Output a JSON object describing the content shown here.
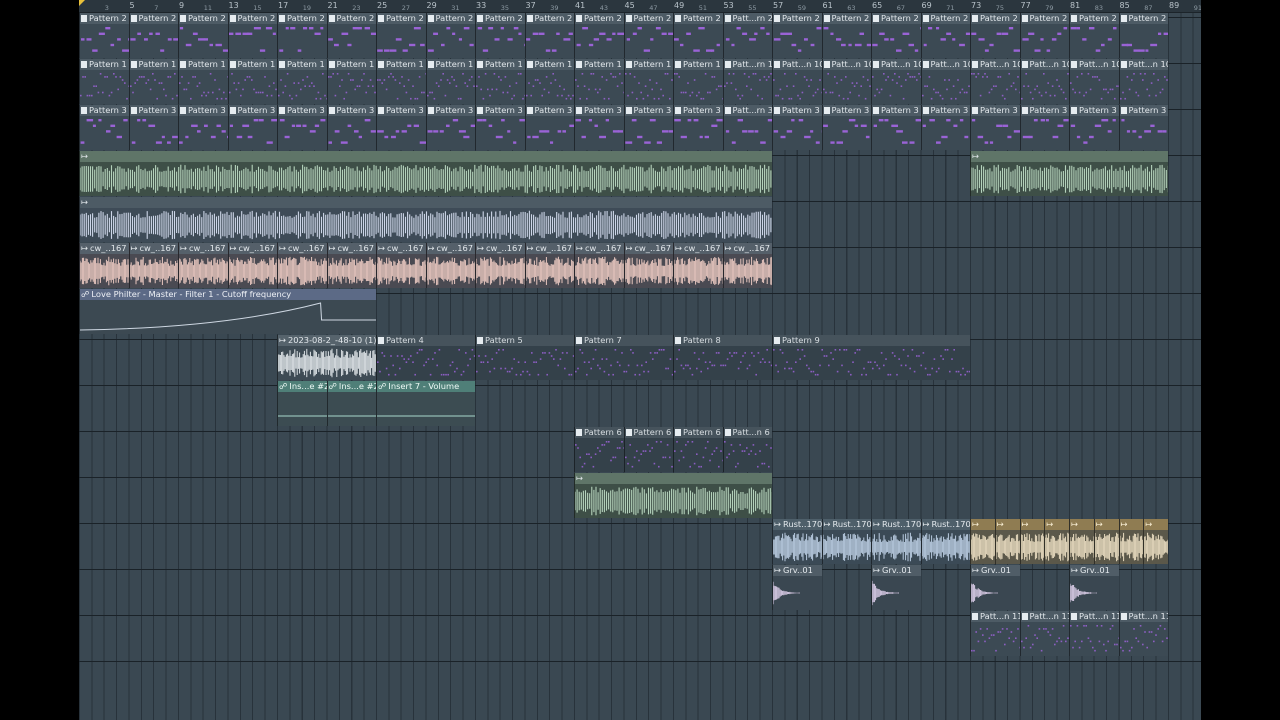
{
  "playlist": {
    "ruler_bars": [
      3,
      5,
      7,
      9,
      11,
      13,
      15,
      17,
      19,
      21,
      23,
      25,
      27,
      29,
      31,
      33,
      35,
      37,
      39,
      41,
      43,
      45,
      47,
      49,
      51,
      53,
      55,
      57,
      59,
      61,
      63,
      65,
      67,
      69,
      71,
      73,
      75,
      77,
      79,
      81,
      83,
      85,
      87,
      89,
      91
    ],
    "clips": [
      {
        "label": "Pattern 2",
        "kind": "pattern",
        "track": 0,
        "start": 1,
        "len": 4
      },
      {
        "label": "Pattern 2",
        "kind": "pattern",
        "track": 0,
        "start": 5,
        "len": 4
      },
      {
        "label": "Pattern 2",
        "kind": "pattern",
        "track": 0,
        "start": 9,
        "len": 4
      },
      {
        "label": "Pattern 2",
        "kind": "pattern",
        "track": 0,
        "start": 13,
        "len": 4
      },
      {
        "label": "Pattern 2",
        "kind": "pattern",
        "track": 0,
        "start": 17,
        "len": 4
      },
      {
        "label": "Pattern 2",
        "kind": "pattern",
        "track": 0,
        "start": 21,
        "len": 4
      },
      {
        "label": "Pattern 2",
        "kind": "pattern",
        "track": 0,
        "start": 25,
        "len": 4
      },
      {
        "label": "Pattern 2",
        "kind": "pattern",
        "track": 0,
        "start": 29,
        "len": 4
      },
      {
        "label": "Pattern 2",
        "kind": "pattern",
        "track": 0,
        "start": 33,
        "len": 4
      },
      {
        "label": "Pattern 2",
        "kind": "pattern",
        "track": 0,
        "start": 37,
        "len": 4
      },
      {
        "label": "Pattern 2",
        "kind": "pattern",
        "track": 0,
        "start": 41,
        "len": 4
      },
      {
        "label": "Pattern 2",
        "kind": "pattern",
        "track": 0,
        "start": 45,
        "len": 4
      },
      {
        "label": "Pattern 2",
        "kind": "pattern",
        "track": 0,
        "start": 49,
        "len": 4
      },
      {
        "label": "Patt...rn 2",
        "kind": "pattern",
        "track": 0,
        "start": 53,
        "len": 4
      },
      {
        "label": "Pattern 2",
        "kind": "pattern",
        "track": 0,
        "start": 57,
        "len": 4
      },
      {
        "label": "Pattern 2",
        "kind": "pattern",
        "track": 0,
        "start": 61,
        "len": 4
      },
      {
        "label": "Pattern 2",
        "kind": "pattern",
        "track": 0,
        "start": 65,
        "len": 4
      },
      {
        "label": "Pattern 2",
        "kind": "pattern",
        "track": 0,
        "start": 69,
        "len": 4
      },
      {
        "label": "Pattern 2",
        "kind": "pattern",
        "track": 0,
        "start": 73,
        "len": 4
      },
      {
        "label": "Pattern 2",
        "kind": "pattern",
        "track": 0,
        "start": 77,
        "len": 4
      },
      {
        "label": "Pattern 2",
        "kind": "pattern",
        "track": 0,
        "start": 81,
        "len": 4
      },
      {
        "label": "Pattern 2",
        "kind": "pattern",
        "track": 0,
        "start": 85,
        "len": 4
      },
      {
        "label": "Pattern 1",
        "kind": "pattern",
        "track": 1,
        "start": 1,
        "len": 4
      },
      {
        "label": "Pattern 1",
        "kind": "pattern",
        "track": 1,
        "start": 5,
        "len": 4
      },
      {
        "label": "Pattern 1",
        "kind": "pattern",
        "track": 1,
        "start": 9,
        "len": 4
      },
      {
        "label": "Pattern 1",
        "kind": "pattern",
        "track": 1,
        "start": 13,
        "len": 4
      },
      {
        "label": "Pattern 1",
        "kind": "pattern",
        "track": 1,
        "start": 17,
        "len": 4
      },
      {
        "label": "Pattern 1",
        "kind": "pattern",
        "track": 1,
        "start": 21,
        "len": 4
      },
      {
        "label": "Pattern 1",
        "kind": "pattern",
        "track": 1,
        "start": 25,
        "len": 4
      },
      {
        "label": "Pattern 1",
        "kind": "pattern",
        "track": 1,
        "start": 29,
        "len": 4
      },
      {
        "label": "Pattern 1",
        "kind": "pattern",
        "track": 1,
        "start": 33,
        "len": 4
      },
      {
        "label": "Pattern 1",
        "kind": "pattern",
        "track": 1,
        "start": 37,
        "len": 4
      },
      {
        "label": "Pattern 1",
        "kind": "pattern",
        "track": 1,
        "start": 41,
        "len": 4
      },
      {
        "label": "Pattern 1",
        "kind": "pattern",
        "track": 1,
        "start": 45,
        "len": 4
      },
      {
        "label": "Pattern 1",
        "kind": "pattern",
        "track": 1,
        "start": 49,
        "len": 4
      },
      {
        "label": "Patt...rn 1",
        "kind": "pattern",
        "track": 1,
        "start": 53,
        "len": 4
      },
      {
        "label": "Patt...n 10",
        "kind": "pattern",
        "track": 1,
        "start": 57,
        "len": 4
      },
      {
        "label": "Patt...n 10",
        "kind": "pattern",
        "track": 1,
        "start": 61,
        "len": 4
      },
      {
        "label": "Patt...n 10",
        "kind": "pattern",
        "track": 1,
        "start": 65,
        "len": 4
      },
      {
        "label": "Patt...n 10",
        "kind": "pattern",
        "track": 1,
        "start": 69,
        "len": 4
      },
      {
        "label": "Patt...n 10",
        "kind": "pattern",
        "track": 1,
        "start": 73,
        "len": 4
      },
      {
        "label": "Patt...n 10",
        "kind": "pattern",
        "track": 1,
        "start": 77,
        "len": 4
      },
      {
        "label": "Patt...n 10",
        "kind": "pattern",
        "track": 1,
        "start": 81,
        "len": 4
      },
      {
        "label": "Patt...n 10",
        "kind": "pattern",
        "track": 1,
        "start": 85,
        "len": 4
      },
      {
        "label": "Pattern 3",
        "kind": "pattern",
        "track": 2,
        "start": 1,
        "len": 4
      },
      {
        "label": "Pattern 3",
        "kind": "pattern",
        "track": 2,
        "start": 5,
        "len": 4
      },
      {
        "label": "Pattern 3",
        "kind": "pattern",
        "track": 2,
        "start": 9,
        "len": 4
      },
      {
        "label": "Pattern 3",
        "kind": "pattern",
        "track": 2,
        "start": 13,
        "len": 4
      },
      {
        "label": "Pattern 3",
        "kind": "pattern",
        "track": 2,
        "start": 17,
        "len": 4
      },
      {
        "label": "Pattern 3",
        "kind": "pattern",
        "track": 2,
        "start": 21,
        "len": 4
      },
      {
        "label": "Pattern 3",
        "kind": "pattern",
        "track": 2,
        "start": 25,
        "len": 4
      },
      {
        "label": "Pattern 3",
        "kind": "pattern",
        "track": 2,
        "start": 29,
        "len": 4
      },
      {
        "label": "Pattern 3",
        "kind": "pattern",
        "track": 2,
        "start": 33,
        "len": 4
      },
      {
        "label": "Pattern 3",
        "kind": "pattern",
        "track": 2,
        "start": 37,
        "len": 4
      },
      {
        "label": "Pattern 3",
        "kind": "pattern",
        "track": 2,
        "start": 41,
        "len": 4
      },
      {
        "label": "Pattern 3",
        "kind": "pattern",
        "track": 2,
        "start": 45,
        "len": 4
      },
      {
        "label": "Pattern 3",
        "kind": "pattern",
        "track": 2,
        "start": 49,
        "len": 4
      },
      {
        "label": "Patt...rn 3",
        "kind": "pattern",
        "track": 2,
        "start": 53,
        "len": 4
      },
      {
        "label": "Pattern 3",
        "kind": "pattern",
        "track": 2,
        "start": 57,
        "len": 4
      },
      {
        "label": "Pattern 3",
        "kind": "pattern",
        "track": 2,
        "start": 61,
        "len": 4
      },
      {
        "label": "Pattern 3",
        "kind": "pattern",
        "track": 2,
        "start": 65,
        "len": 4
      },
      {
        "label": "Pattern 3",
        "kind": "pattern",
        "track": 2,
        "start": 69,
        "len": 4
      },
      {
        "label": "Pattern 3",
        "kind": "pattern",
        "track": 2,
        "start": 73,
        "len": 4
      },
      {
        "label": "Pattern 3",
        "kind": "pattern",
        "track": 2,
        "start": 77,
        "len": 4
      },
      {
        "label": "Pattern 3",
        "kind": "pattern",
        "track": 2,
        "start": 81,
        "len": 4
      },
      {
        "label": "Pattern 3",
        "kind": "pattern",
        "track": 2,
        "start": 85,
        "len": 4
      },
      {
        "label": "",
        "kind": "audio-green",
        "track": 3,
        "start": 1,
        "len": 56
      },
      {
        "label": "",
        "kind": "audio-green",
        "track": 3,
        "start": 73,
        "len": 16
      },
      {
        "label": "",
        "kind": "audio-blue",
        "track": 4,
        "start": 1,
        "len": 56
      },
      {
        "label": "cw_..167",
        "kind": "audio-pink",
        "track": 5,
        "start": 1,
        "len": 4
      },
      {
        "label": "cw_..167",
        "kind": "audio-pink",
        "track": 5,
        "start": 5,
        "len": 4
      },
      {
        "label": "cw_..167",
        "kind": "audio-pink",
        "track": 5,
        "start": 9,
        "len": 4
      },
      {
        "label": "cw_..167",
        "kind": "audio-pink",
        "track": 5,
        "start": 13,
        "len": 4
      },
      {
        "label": "cw_..167",
        "kind": "audio-pink",
        "track": 5,
        "start": 17,
        "len": 4
      },
      {
        "label": "cw_..167",
        "kind": "audio-pink",
        "track": 5,
        "start": 21,
        "len": 4
      },
      {
        "label": "cw_..167",
        "kind": "audio-pink",
        "track": 5,
        "start": 25,
        "len": 4
      },
      {
        "label": "cw_..167",
        "kind": "audio-pink",
        "track": 5,
        "start": 29,
        "len": 4
      },
      {
        "label": "cw_..167",
        "kind": "audio-pink",
        "track": 5,
        "start": 33,
        "len": 4
      },
      {
        "label": "cw_..167",
        "kind": "audio-pink",
        "track": 5,
        "start": 37,
        "len": 4
      },
      {
        "label": "cw_..167",
        "kind": "audio-pink",
        "track": 5,
        "start": 41,
        "len": 4
      },
      {
        "label": "cw_..167",
        "kind": "audio-pink",
        "track": 5,
        "start": 45,
        "len": 4
      },
      {
        "label": "cw_..167",
        "kind": "audio-pink",
        "track": 5,
        "start": 49,
        "len": 4
      },
      {
        "label": "cw_..167",
        "kind": "audio-pink",
        "track": 5,
        "start": 53,
        "len": 4
      },
      {
        "label": "Love Philter - Master - Filter 1 - Cutoff frequency",
        "kind": "automation",
        "track": 6,
        "start": 1,
        "len": 24
      },
      {
        "label": "2023-08-2_-48-10 (1)",
        "kind": "audio-grey",
        "track": 7,
        "start": 17,
        "len": 8
      },
      {
        "label": "Pattern 4",
        "kind": "pattern-dark",
        "track": 7,
        "start": 25,
        "len": 8
      },
      {
        "label": "Pattern 5",
        "kind": "pattern-dark",
        "track": 7,
        "start": 33,
        "len": 8
      },
      {
        "label": "Pattern 7",
        "kind": "pattern-dark",
        "track": 7,
        "start": 41,
        "len": 8
      },
      {
        "label": "Pattern 8",
        "kind": "pattern-dark",
        "track": 7,
        "start": 49,
        "len": 8
      },
      {
        "label": "Pattern 9",
        "kind": "pattern-dark",
        "track": 7,
        "start": 57,
        "len": 16
      },
      {
        "label": "Ins...e #2",
        "kind": "automation-teal",
        "track": 8,
        "start": 17,
        "len": 4
      },
      {
        "label": "Ins...e #2",
        "kind": "automation-teal",
        "track": 8,
        "start": 21,
        "len": 4
      },
      {
        "label": "Insert 7 - Volume",
        "kind": "automation-teal",
        "track": 8,
        "start": 25,
        "len": 8
      },
      {
        "label": "Pattern 6",
        "kind": "pattern-dark",
        "track": 9,
        "start": 41,
        "len": 4
      },
      {
        "label": "Pattern 6",
        "kind": "pattern-dark",
        "track": 9,
        "start": 45,
        "len": 4
      },
      {
        "label": "Pattern 6",
        "kind": "pattern-dark",
        "track": 9,
        "start": 49,
        "len": 4
      },
      {
        "label": "Patt...n 6",
        "kind": "pattern-dark",
        "track": 9,
        "start": 53,
        "len": 4
      },
      {
        "label": "",
        "kind": "audio-green",
        "track": 10,
        "start": 41,
        "len": 16
      },
      {
        "label": "Rust..170",
        "kind": "audio-blue2",
        "track": 11,
        "start": 57,
        "len": 4
      },
      {
        "label": "Rust..170",
        "kind": "audio-blue2",
        "track": 11,
        "start": 61,
        "len": 4
      },
      {
        "label": "Rust..170",
        "kind": "audio-blue2",
        "track": 11,
        "start": 65,
        "len": 4
      },
      {
        "label": "Rust..170",
        "kind": "audio-blue2",
        "track": 11,
        "start": 69,
        "len": 4
      },
      {
        "label": "",
        "kind": "audio-cream",
        "track": 11,
        "start": 73,
        "len": 2
      },
      {
        "label": "",
        "kind": "audio-cream",
        "track": 11,
        "start": 75,
        "len": 2
      },
      {
        "label": "",
        "kind": "audio-cream",
        "track": 11,
        "start": 77,
        "len": 2
      },
      {
        "label": "",
        "kind": "audio-cream",
        "track": 11,
        "start": 79,
        "len": 2
      },
      {
        "label": "",
        "kind": "audio-cream",
        "track": 11,
        "start": 81,
        "len": 2
      },
      {
        "label": "",
        "kind": "audio-cream",
        "track": 11,
        "start": 83,
        "len": 2
      },
      {
        "label": "",
        "kind": "audio-cream",
        "track": 11,
        "start": 85,
        "len": 2
      },
      {
        "label": "",
        "kind": "audio-cream",
        "track": 11,
        "start": 87,
        "len": 2
      },
      {
        "label": "Grv..01",
        "kind": "audio-lilac",
        "track": 12,
        "start": 57,
        "len": 4
      },
      {
        "label": "Grv..01",
        "kind": "audio-lilac",
        "track": 12,
        "start": 65,
        "len": 4
      },
      {
        "label": "Grv..01",
        "kind": "audio-lilac",
        "track": 12,
        "start": 73,
        "len": 4
      },
      {
        "label": "Grv..01",
        "kind": "audio-lilac",
        "track": 12,
        "start": 81,
        "len": 4
      },
      {
        "label": "Patt...n 11",
        "kind": "pattern",
        "track": 13,
        "start": 73,
        "len": 4
      },
      {
        "label": "Patt...n 11",
        "kind": "pattern",
        "track": 13,
        "start": 77,
        "len": 4
      },
      {
        "label": "Patt...n 11",
        "kind": "pattern",
        "track": 13,
        "start": 81,
        "len": 4
      },
      {
        "label": "Patt...n 11",
        "kind": "pattern",
        "track": 13,
        "start": 85,
        "len": 4
      }
    ]
  },
  "colors": {
    "background": "#3a4852",
    "pattern_head": "#4a5862",
    "pattern_body": "#35434d",
    "note_purple": "#9a63d6",
    "audio_green": "#b5d3bc",
    "audio_blue": "#cdd6e8",
    "audio_pink": "#e8c7bf",
    "automation_teal": "#6aa89a",
    "ruler_start": "#e9c13a"
  },
  "icons": {
    "pattern_clip": "pattern-clip-icon",
    "audio_clip": "audio-clip-icon",
    "automation_clip": "automation-clip-icon"
  }
}
